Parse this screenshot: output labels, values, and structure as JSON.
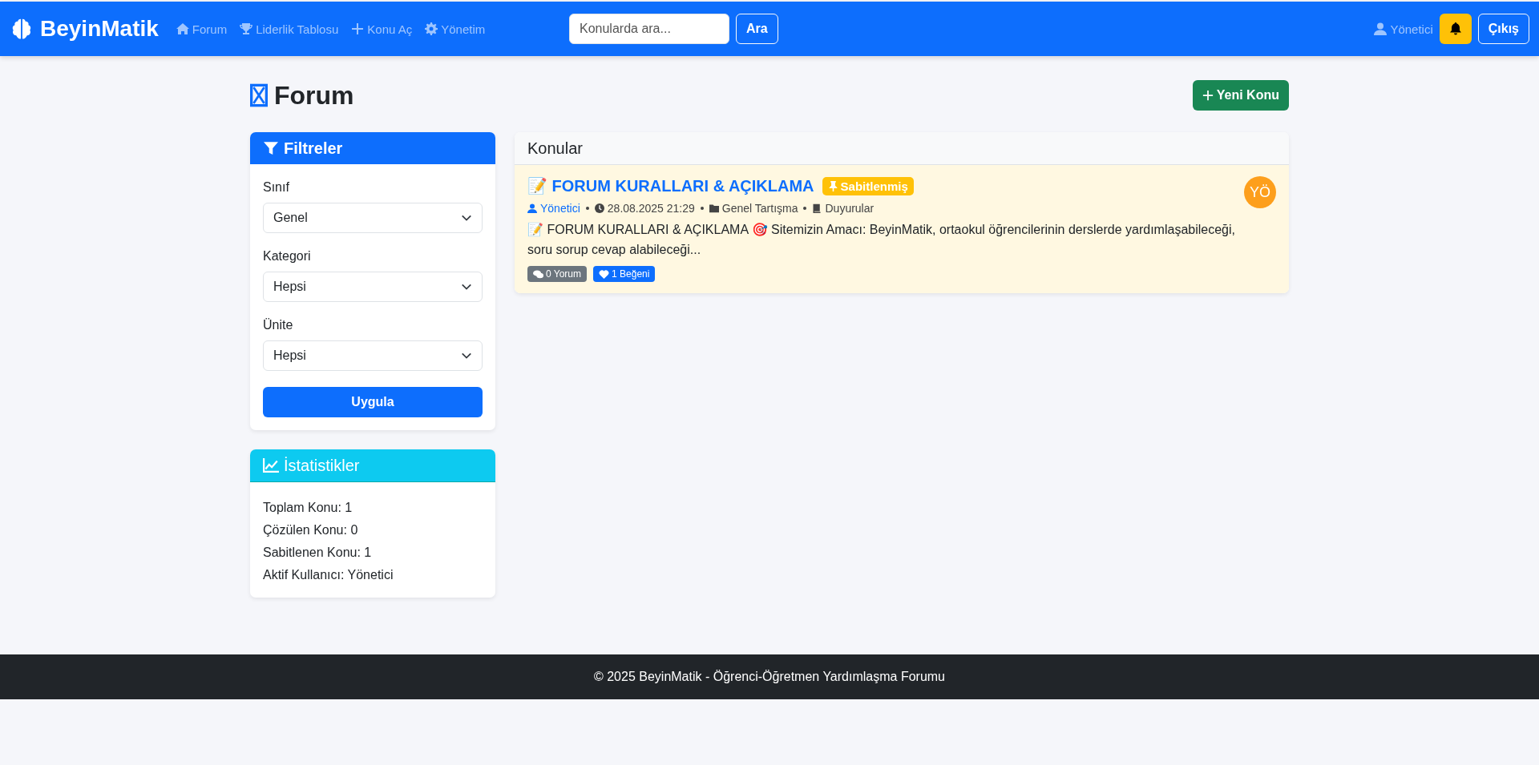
{
  "navbar": {
    "brand": "BeyinMatik",
    "links": [
      {
        "kind": "home",
        "label": "Forum"
      },
      {
        "kind": "trophy",
        "label": "Liderlik Tablosu"
      },
      {
        "kind": "plus",
        "label": "Konu Aç"
      },
      {
        "kind": "gear",
        "label": "Yönetim"
      }
    ],
    "search": {
      "placeholder": "Konularda ara...",
      "button": "Ara"
    },
    "user": "Yönetici",
    "logout": "Çıkış"
  },
  "page": {
    "title": "Forum",
    "new_topic_button": "Yeni Konu"
  },
  "filters": {
    "title": "Filtreler",
    "fields": [
      {
        "label": "Sınıf",
        "value": "Genel"
      },
      {
        "label": "Kategori",
        "value": "Hepsi"
      },
      {
        "label": "Ünite",
        "value": "Hepsi"
      }
    ],
    "apply_button": "Uygula"
  },
  "stats": {
    "title": "İstatistikler",
    "lines": [
      "Toplam Konu: 1",
      "Çözülen Konu: 0",
      "Sabitlenen Konu: 1",
      "Aktif Kullanıcı: Yönetici"
    ]
  },
  "topics": {
    "title": "Konular",
    "items": [
      {
        "title": "📝 FORUM KURALLARI & AÇIKLAMA",
        "pinned": true,
        "pin_label": "Sabitlenmiş",
        "author": "Yönetici",
        "date": "28.08.2025 21:29",
        "category": "Genel Tartışma",
        "subcategory": "Duyurular",
        "excerpt": "📝 FORUM KURALLARI & AÇIKLAMA 🎯 Sitemizin Amacı: BeyinMatik, ortaokul öğrencilerinin derslerde yardımlaşabileceği, soru sorup cevap alabileceği...",
        "comments": "0 Yorum",
        "likes": "1 Beğeni",
        "avatar": "YÖ"
      }
    ]
  },
  "footer": "© 2025 BeyinMatik - Öğrenci-Öğretmen Yardımlaşma Forumu"
}
